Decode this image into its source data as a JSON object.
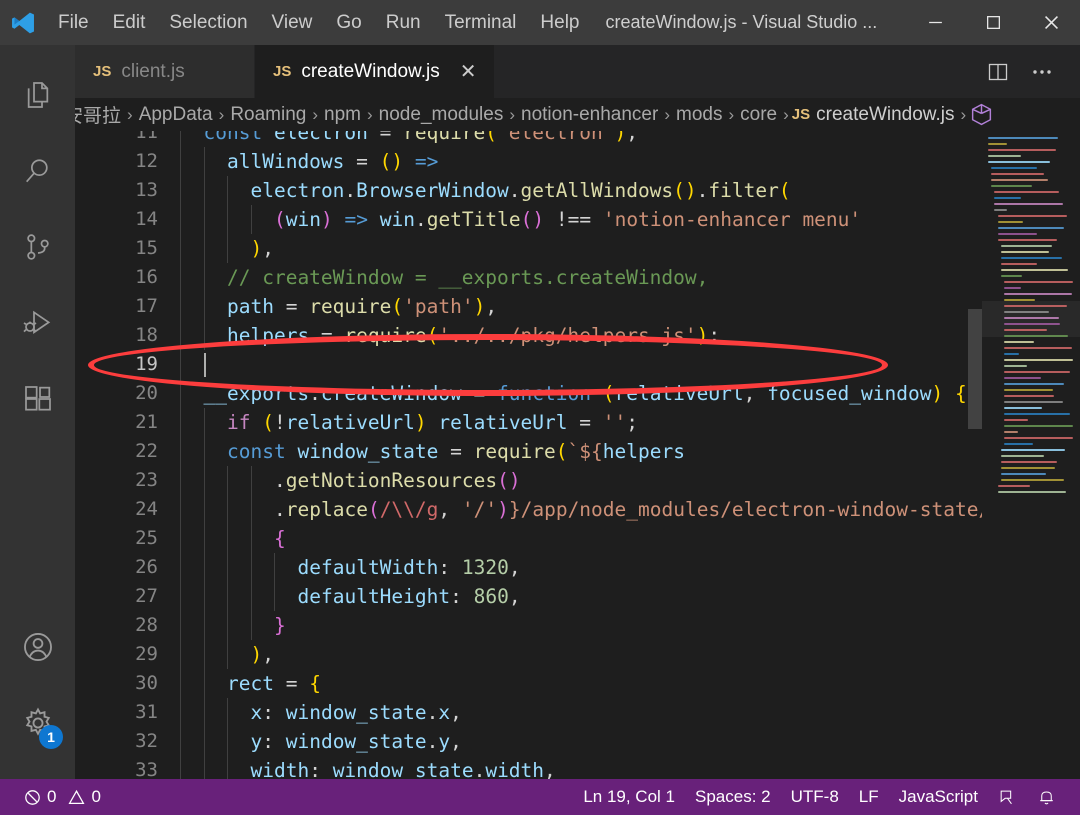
{
  "window": {
    "title": "createWindow.js - Visual Studio ...",
    "minimize_label": "Minimize",
    "maximize_label": "Maximize",
    "close_label": "Close"
  },
  "menu": {
    "items": [
      "File",
      "Edit",
      "Selection",
      "View",
      "Go",
      "Run",
      "Terminal",
      "Help"
    ]
  },
  "activitybar": {
    "items": [
      {
        "name": "explorer",
        "icon": "files-icon",
        "active": false
      },
      {
        "name": "search",
        "icon": "search-icon",
        "active": false
      },
      {
        "name": "source-control",
        "icon": "source-control-icon",
        "active": false
      },
      {
        "name": "run-and-debug",
        "icon": "run-debug-icon",
        "active": false
      },
      {
        "name": "extensions",
        "icon": "extensions-icon",
        "active": false
      }
    ],
    "bottom": [
      {
        "name": "accounts",
        "icon": "account-icon",
        "badge": ""
      },
      {
        "name": "manage",
        "icon": "gear-icon",
        "badge": "1"
      }
    ]
  },
  "tabs": [
    {
      "label": "client.js",
      "badge": "JS",
      "active": false,
      "closable": false
    },
    {
      "label": "createWindow.js",
      "badge": "JS",
      "active": true,
      "closable": true
    }
  ],
  "tabbar_actions": [
    {
      "name": "split-editor",
      "icon": "split-editor-icon"
    },
    {
      "name": "more-actions",
      "icon": "ellipsis-icon"
    }
  ],
  "breadcrumb": {
    "items": [
      "安哥拉",
      "AppData",
      "Roaming",
      "npm",
      "node_modules",
      "notion-enhancer",
      "mods",
      "core"
    ],
    "file": "createWindow.js",
    "file_badge": "JS",
    "symbol_icon": "cube-icon",
    "separator": "›"
  },
  "editor": {
    "first_line": 11,
    "cursor_line": 19,
    "lines": [
      {
        "n": 11,
        "indent": 1,
        "tokens": [
          [
            "kw",
            "const"
          ],
          [
            "pl",
            " "
          ],
          [
            "var",
            "electron"
          ],
          [
            "pl",
            " = "
          ],
          [
            "fn",
            "require"
          ],
          [
            "br1",
            "("
          ],
          [
            "str",
            "'electron'"
          ],
          [
            "br1",
            ")"
          ],
          [
            "pl",
            ","
          ]
        ]
      },
      {
        "n": 12,
        "indent": 2,
        "tokens": [
          [
            "var",
            "allWindows"
          ],
          [
            "pl",
            " = "
          ],
          [
            "br1",
            "("
          ],
          [
            "br1",
            ")"
          ],
          [
            "pl",
            " "
          ],
          [
            "kw",
            "=>"
          ]
        ]
      },
      {
        "n": 13,
        "indent": 3,
        "tokens": [
          [
            "var",
            "electron"
          ],
          [
            "pl",
            "."
          ],
          [
            "var",
            "BrowserWindow"
          ],
          [
            "pl",
            "."
          ],
          [
            "fn",
            "getAllWindows"
          ],
          [
            "br1",
            "("
          ],
          [
            "br1",
            ")"
          ],
          [
            "pl",
            "."
          ],
          [
            "fn",
            "filter"
          ],
          [
            "br1",
            "("
          ]
        ]
      },
      {
        "n": 14,
        "indent": 4,
        "tokens": [
          [
            "br2",
            "("
          ],
          [
            "var",
            "win"
          ],
          [
            "br2",
            ")"
          ],
          [
            "pl",
            " "
          ],
          [
            "kw",
            "=>"
          ],
          [
            "pl",
            " "
          ],
          [
            "var",
            "win"
          ],
          [
            "pl",
            "."
          ],
          [
            "fn",
            "getTitle"
          ],
          [
            "br2",
            "("
          ],
          [
            "br2",
            ")"
          ],
          [
            "pl",
            " "
          ],
          [
            "pl",
            "!=="
          ],
          [
            "pl",
            " "
          ],
          [
            "str",
            "'notion-enhancer menu'"
          ]
        ]
      },
      {
        "n": 15,
        "indent": 3,
        "tokens": [
          [
            "br1",
            ")"
          ],
          [
            "pl",
            ","
          ]
        ]
      },
      {
        "n": 16,
        "indent": 2,
        "tokens": [
          [
            "cmt",
            "// createWindow = __exports.createWindow,"
          ]
        ]
      },
      {
        "n": 17,
        "indent": 2,
        "tokens": [
          [
            "var",
            "path"
          ],
          [
            "pl",
            " = "
          ],
          [
            "fn",
            "require"
          ],
          [
            "br1",
            "("
          ],
          [
            "str",
            "'path'"
          ],
          [
            "br1",
            ")"
          ],
          [
            "pl",
            ","
          ]
        ]
      },
      {
        "n": 18,
        "indent": 2,
        "tokens": [
          [
            "var",
            "helpers"
          ],
          [
            "pl",
            " = "
          ],
          [
            "fn",
            "require"
          ],
          [
            "br1",
            "("
          ],
          [
            "str",
            "'../../pkg/helpers.js'"
          ],
          [
            "br1",
            ")"
          ],
          [
            "pl",
            ";"
          ]
        ]
      },
      {
        "n": 19,
        "indent": 1,
        "tokens": [],
        "cursor": true
      },
      {
        "n": 20,
        "indent": 1,
        "tokens": [
          [
            "var",
            "__exports"
          ],
          [
            "pl",
            "."
          ],
          [
            "var",
            "createWindow"
          ],
          [
            "pl",
            " = "
          ],
          [
            "kw",
            "function"
          ],
          [
            "pl",
            " "
          ],
          [
            "br1",
            "("
          ],
          [
            "var",
            "relativeUrl"
          ],
          [
            "pl",
            ", "
          ],
          [
            "var",
            "focused_window"
          ],
          [
            "br1",
            ")"
          ],
          [
            "pl",
            " "
          ],
          [
            "br1",
            "{"
          ]
        ]
      },
      {
        "n": 21,
        "indent": 2,
        "tokens": [
          [
            "kw2",
            "if"
          ],
          [
            "pl",
            " "
          ],
          [
            "br1",
            "("
          ],
          [
            "pl",
            "!"
          ],
          [
            "var",
            "relativeUrl"
          ],
          [
            "br1",
            ")"
          ],
          [
            "pl",
            " "
          ],
          [
            "var",
            "relativeUrl"
          ],
          [
            "pl",
            " = "
          ],
          [
            "str",
            "''"
          ],
          [
            "pl",
            ";"
          ]
        ]
      },
      {
        "n": 22,
        "indent": 2,
        "tokens": [
          [
            "kw",
            "const"
          ],
          [
            "pl",
            " "
          ],
          [
            "var",
            "window_state"
          ],
          [
            "pl",
            " = "
          ],
          [
            "fn",
            "require"
          ],
          [
            "br1",
            "("
          ],
          [
            "str",
            "`${"
          ],
          [
            "var",
            "helpers"
          ]
        ]
      },
      {
        "n": 23,
        "indent": 4,
        "tokens": [
          [
            "pl",
            "."
          ],
          [
            "fn",
            "getNotionResources"
          ],
          [
            "br2",
            "("
          ],
          [
            "br2",
            ")"
          ]
        ]
      },
      {
        "n": 24,
        "indent": 4,
        "tokens": [
          [
            "pl",
            "."
          ],
          [
            "fn",
            "replace"
          ],
          [
            "br2",
            "("
          ],
          [
            "rx",
            "/\\\\/g"
          ],
          [
            "pl",
            ", "
          ],
          [
            "str",
            "'/'"
          ],
          [
            "br2",
            ")"
          ],
          [
            "str",
            "}"
          ],
          [
            "str",
            "/app/node_modules/electron-window-state/in"
          ]
        ]
      },
      {
        "n": 25,
        "indent": 4,
        "tokens": [
          [
            "br2",
            "{"
          ]
        ]
      },
      {
        "n": 26,
        "indent": 5,
        "tokens": [
          [
            "var",
            "defaultWidth"
          ],
          [
            "pl",
            ": "
          ],
          [
            "num",
            "1320"
          ],
          [
            "pl",
            ","
          ]
        ]
      },
      {
        "n": 27,
        "indent": 5,
        "tokens": [
          [
            "var",
            "defaultHeight"
          ],
          [
            "pl",
            ": "
          ],
          [
            "num",
            "860"
          ],
          [
            "pl",
            ","
          ]
        ]
      },
      {
        "n": 28,
        "indent": 4,
        "tokens": [
          [
            "br2",
            "}"
          ]
        ]
      },
      {
        "n": 29,
        "indent": 3,
        "tokens": [
          [
            "br1",
            ")"
          ],
          [
            "pl",
            ","
          ]
        ]
      },
      {
        "n": 30,
        "indent": 2,
        "tokens": [
          [
            "var",
            "rect"
          ],
          [
            "pl",
            " = "
          ],
          [
            "br1",
            "{"
          ]
        ]
      },
      {
        "n": 31,
        "indent": 3,
        "tokens": [
          [
            "var",
            "x"
          ],
          [
            "pl",
            ": "
          ],
          [
            "var",
            "window_state"
          ],
          [
            "pl",
            "."
          ],
          [
            "var",
            "x"
          ],
          [
            "pl",
            ","
          ]
        ]
      },
      {
        "n": 32,
        "indent": 3,
        "tokens": [
          [
            "var",
            "y"
          ],
          [
            "pl",
            ": "
          ],
          [
            "var",
            "window_state"
          ],
          [
            "pl",
            "."
          ],
          [
            "var",
            "y"
          ],
          [
            "pl",
            ","
          ]
        ]
      },
      {
        "n": 33,
        "indent": 3,
        "tokens": [
          [
            "var",
            "width"
          ],
          [
            "pl",
            ": "
          ],
          [
            "var",
            "window_state"
          ],
          [
            "pl",
            "."
          ],
          [
            "var",
            "width"
          ],
          [
            "pl",
            ","
          ]
        ]
      }
    ]
  },
  "annotation": {
    "type": "ellipse-highlight",
    "color": "#fc3d3d",
    "targets_line": 19
  },
  "statusbar": {
    "errors": "0",
    "warnings": "0",
    "position": "Ln 19, Col 1",
    "indentation": "Spaces: 2",
    "encoding": "UTF-8",
    "eol": "LF",
    "language": "JavaScript",
    "feedback_icon": "tweet-feedback-icon",
    "notifications_icon": "bell-icon",
    "background": "#68217a"
  },
  "colors": {
    "editor_bg": "#1e1e1e",
    "sidebar_bg": "#333333",
    "titlebar_bg": "#3c3c3c",
    "tab_inactive_bg": "#2d2d2d",
    "status_bg": "#68217a",
    "accent_blue": "#0e77d1",
    "annotation_red": "#fc3d3d"
  }
}
